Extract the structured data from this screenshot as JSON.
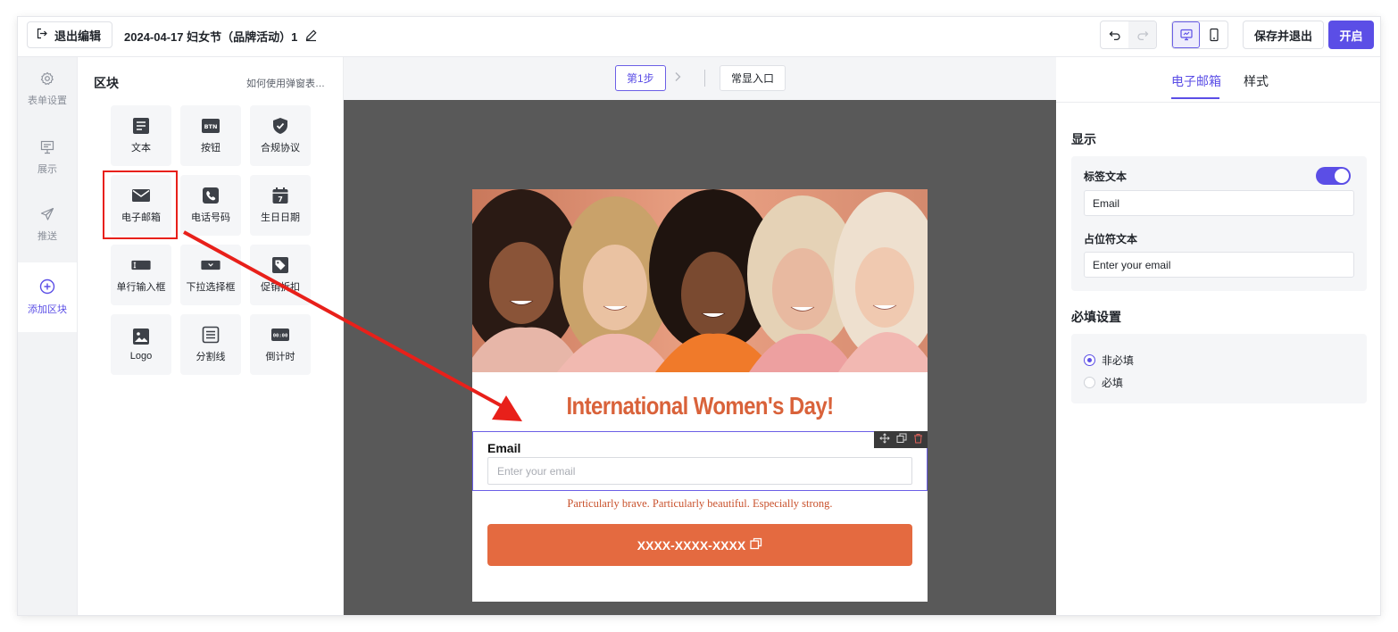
{
  "topbar": {
    "exit_label": "退出编辑",
    "doc_title": "2024-04-17 妇女节（品牌活动）1",
    "save_exit_label": "保存并退出",
    "open_label": "开启"
  },
  "rail": {
    "items": [
      {
        "label": "表单设置",
        "icon": "gear-icon"
      },
      {
        "label": "展示",
        "icon": "presentation-icon"
      },
      {
        "label": "推送",
        "icon": "send-icon"
      },
      {
        "label": "添加区块",
        "icon": "plus-circle-icon"
      }
    ]
  },
  "blocks": {
    "title": "区块",
    "help_link": "如何使用弹窗表单?...",
    "tiles": [
      {
        "label": "文本",
        "icon": "text-icon"
      },
      {
        "label": "按钮",
        "icon": "button-icon"
      },
      {
        "label": "合规协议",
        "icon": "shield-check-icon"
      },
      {
        "label": "电子邮箱",
        "icon": "mail-icon"
      },
      {
        "label": "电话号码",
        "icon": "phone-icon"
      },
      {
        "label": "生日日期",
        "icon": "calendar-icon"
      },
      {
        "label": "单行输入框",
        "icon": "text-input-icon"
      },
      {
        "label": "下拉选择框",
        "icon": "dropdown-icon"
      },
      {
        "label": "促销折扣",
        "icon": "tag-icon"
      },
      {
        "label": "Logo",
        "icon": "image-icon"
      },
      {
        "label": "分割线",
        "icon": "divider-icon"
      },
      {
        "label": "倒计时",
        "icon": "countdown-icon"
      }
    ]
  },
  "canvas": {
    "step_label": "第1步",
    "float_entry_label": "常显入口",
    "popup": {
      "headline": "International Women's Day!",
      "email_label": "Email",
      "email_placeholder": "Enter your email",
      "tagline": "Particularly brave. Particularly beautiful. Especially strong.",
      "coupon_code": "XXXX-XXXX-XXXX"
    }
  },
  "right_panel": {
    "tabs": [
      "电子邮箱",
      "样式"
    ],
    "display_section": "显示",
    "label_text_title": "标签文本",
    "label_text_enabled": true,
    "label_text_value": "Email",
    "placeholder_title": "占位符文本",
    "placeholder_value": "Enter your email",
    "required_section": "必填设置",
    "required_options": [
      "非必填",
      "必填"
    ],
    "required_selected": "非必填"
  },
  "colors": {
    "accent": "#5b4ee6",
    "headline": "#d9623a",
    "coupon_bg": "#e46a40",
    "annotation_red": "#e8201a",
    "canvas_bg": "#595959"
  }
}
